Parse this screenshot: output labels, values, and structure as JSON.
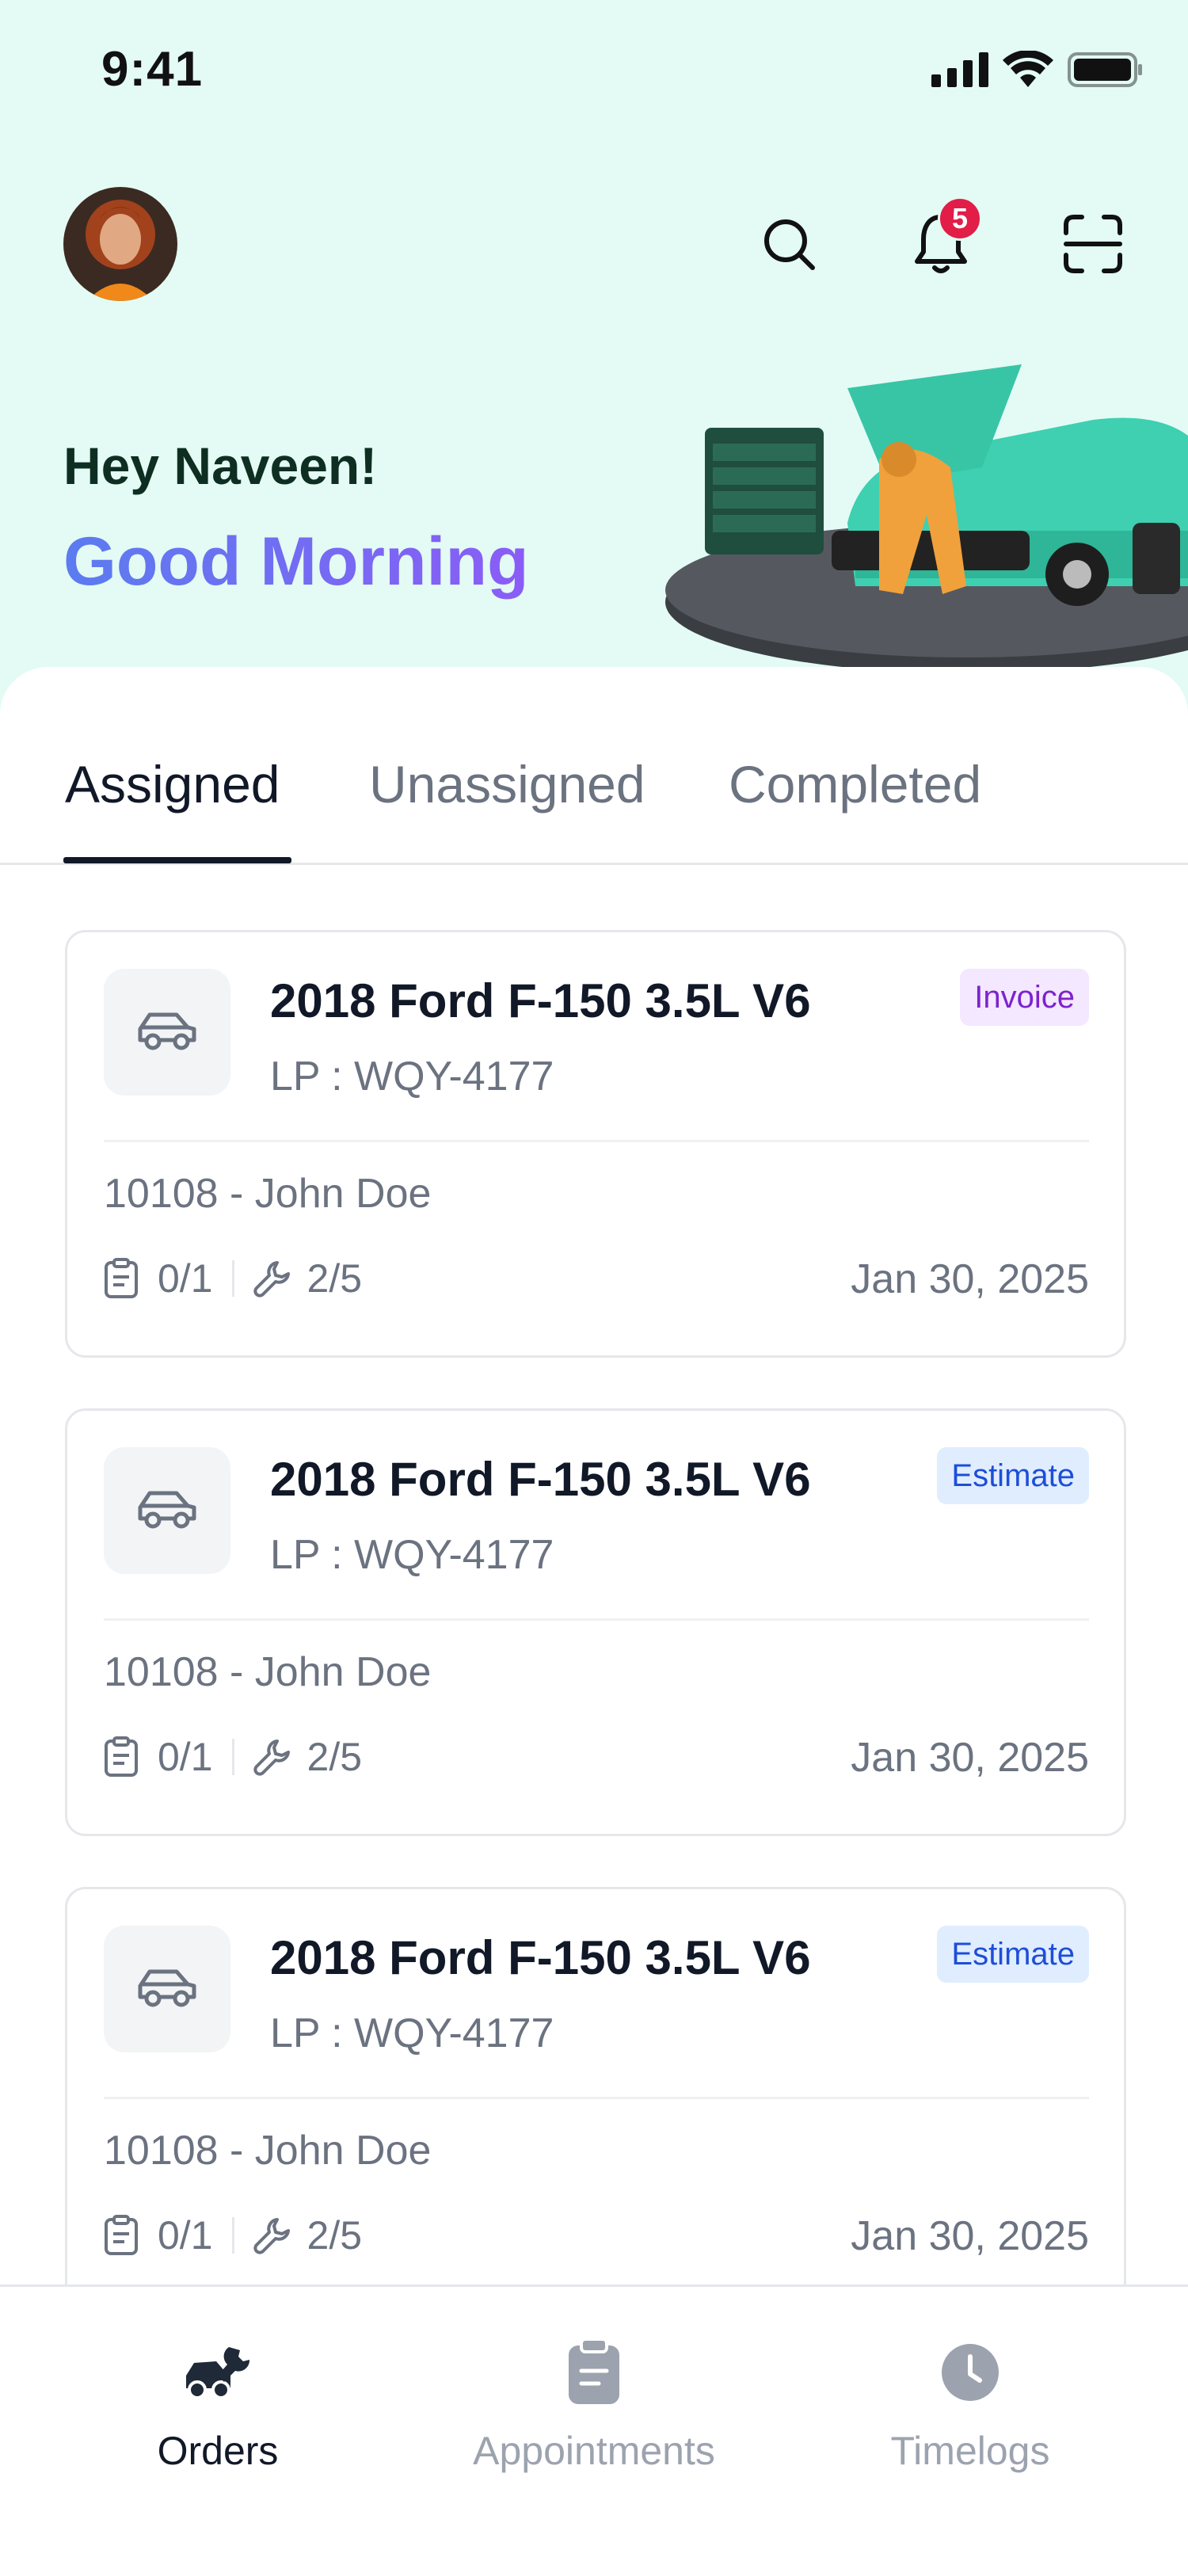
{
  "status_bar": {
    "time": "9:41"
  },
  "header": {
    "notification_count": "5"
  },
  "greeting": {
    "hello": "Hey Naveen!",
    "salutation": "Good Morning"
  },
  "tabs": [
    {
      "label": "Assigned",
      "active": true
    },
    {
      "label": "Unassigned",
      "active": false
    },
    {
      "label": "Completed",
      "active": false
    }
  ],
  "orders": [
    {
      "title": "2018 Ford F-150 3.5L V6",
      "lp": "LP : WQY-4177",
      "tag": "Invoice",
      "customer": "10108 - John Doe",
      "checklist": "0/1",
      "services": "2/5",
      "date": "Jan 30, 2025"
    },
    {
      "title": "2018 Ford F-150 3.5L V6",
      "lp": "LP : WQY-4177",
      "tag": "Estimate",
      "customer": "10108 - John Doe",
      "checklist": "0/1",
      "services": "2/5",
      "date": "Jan 30, 2025"
    },
    {
      "title": "2018 Ford F-150 3.5L V6",
      "lp": "LP : WQY-4177",
      "tag": "Estimate",
      "customer": "10108 - John Doe",
      "checklist": "0/1",
      "services": "2/5",
      "date": "Jan 30, 2025"
    }
  ],
  "bottom_nav": [
    {
      "label": "Orders",
      "icon": "orders-icon",
      "active": true
    },
    {
      "label": "Appointments",
      "icon": "clipboard-icon",
      "active": false
    },
    {
      "label": "Timelogs",
      "icon": "clock-icon",
      "active": false
    }
  ],
  "colors": {
    "hero_bg": "#e3fbf4",
    "accent_gradient_start": "#5b7cf0",
    "accent_gradient_end": "#8b5cf6",
    "badge": "#e11d48"
  }
}
